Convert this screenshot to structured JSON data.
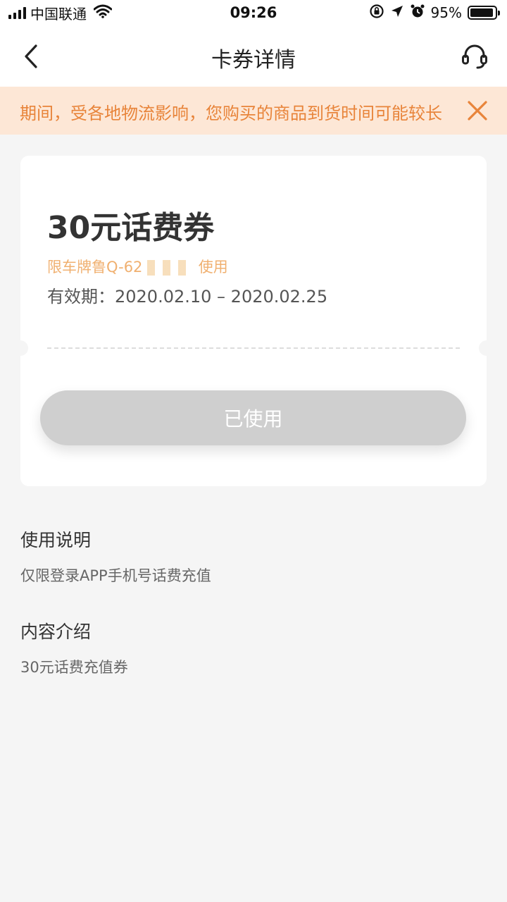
{
  "status_bar": {
    "carrier": "中国联通",
    "time": "09:26",
    "battery": "95%",
    "battery_level": 0.95
  },
  "nav": {
    "title": "卡券详情",
    "back_icon": "chevron-left-icon",
    "service_icon": "headset-icon"
  },
  "notice": {
    "text": "期间，受各地物流影响，您购买的商品到货时间可能较长",
    "close_icon": "close-icon",
    "color": "#e8843a",
    "background": "#fde7d6"
  },
  "coupon": {
    "title": "30元话费券",
    "restriction": "限车牌鲁Q-62",
    "restriction_suffix": "使用",
    "validity_label": "有效期：",
    "validity_range": "2020.02.10 – 2020.02.25",
    "status_button": "已使用"
  },
  "sections": [
    {
      "heading": "使用说明",
      "body": "仅限登录APP手机号话费充值"
    },
    {
      "heading": "内容介绍",
      "body": "30元话费充值券"
    }
  ]
}
